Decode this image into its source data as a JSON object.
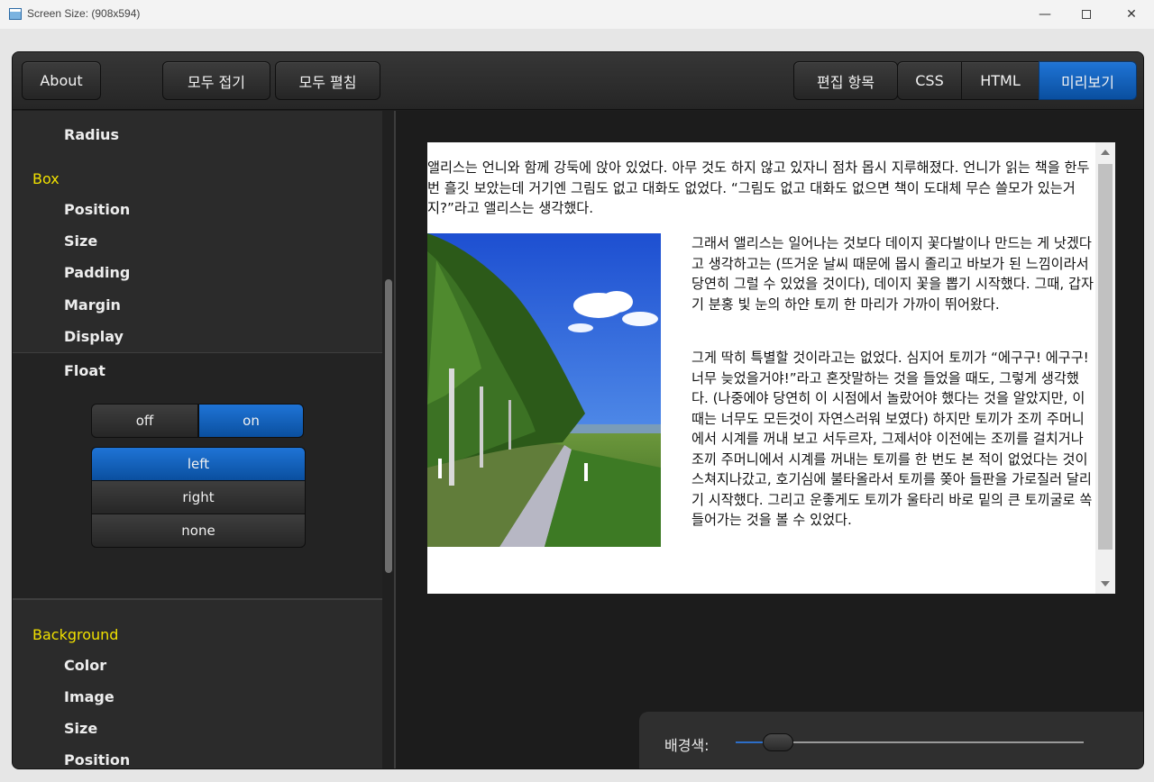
{
  "window": {
    "title": "Screen Size: (908x594)",
    "controls": {
      "minimize": "—",
      "close": "✕"
    }
  },
  "toolbar": {
    "about": "About",
    "collapse_all": "모두 접기",
    "expand_all": "모두 펼침",
    "edit_items": "편집 항목",
    "css": "CSS",
    "html": "HTML",
    "preview": "미리보기",
    "active_tab": "미리보기"
  },
  "sidebar": {
    "radius": "Radius",
    "box_header": "Box",
    "box_items": [
      "Position",
      "Size",
      "Padding",
      "Margin",
      "Display"
    ],
    "float_label": "Float",
    "float_toggle": {
      "off": "off",
      "on": "on",
      "selected": "on"
    },
    "float_options": {
      "left": "left",
      "right": "right",
      "none": "none",
      "selected": "left"
    },
    "background_header": "Background",
    "background_items": [
      "Color",
      "Image",
      "Size",
      "Position"
    ]
  },
  "preview": {
    "paragraph1": "앨리스는 언니와 함께 강둑에 앉아 있었다. 아무 것도 하지 않고 있자니 점차 몹시 지루해졌다. 언니가 읽는 책을 한두 번 흘깃 보았는데 거기엔 그림도 없고 대화도 없었다. “그림도 없고 대화도 없으면 책이 도대체 무슨 쓸모가 있는거지?”라고 앨리스는 생각했다.",
    "paragraph2": "그래서 앨리스는 일어나는 것보다 데이지 꽃다발이나 만드는 게 낫겠다고 생각하고는 (뜨거운 날씨 때문에 몹시 졸리고 바보가 된 느낌이라서 당연히 그럴 수 있었을 것이다), 데이지 꽃을 뽑기 시작했다. 그때, 갑자기 분홍 빛 눈의 하얀 토끼 한 마리가 가까이 뛰어왔다.",
    "paragraph3": "그게 딱히 특별할 것이라고는 없었다. 심지어 토끼가 “에구구! 에구구! 너무 늦었을거야!”라고 혼잣말하는 것을 들었을 때도, 그렇게 생각했다. (나중에야 당연히 이 시점에서 놀랐어야 했다는 것을 알았지만, 이때는 너무도 모든것이 자연스러워 보였다) 하지만 토끼가 조끼 주머니에서 시계를 꺼내 보고 서두르자, 그제서야 이전에는 조끼를 걸치거나 조끼 주머니에서 시계를 꺼내는 토끼를 한 번도 본 적이 없었다는 것이 스쳐지나갔고, 호기심에 불타올라서 토끼를 쫒아 들판을 가로질러 달리기 시작했다. 그리고 운좋게도 토끼가 울타리 바로 밑의 큰 토끼굴로 쏙 들어가는 것을 볼 수 있었다.",
    "image": "tree-lined-road-photo"
  },
  "background_panel": {
    "label": "배경색:",
    "slider_value": 0.08
  },
  "colors": {
    "accent": "#1565c0",
    "section_header": "#f0e000",
    "note_red": "#d41b1b"
  }
}
